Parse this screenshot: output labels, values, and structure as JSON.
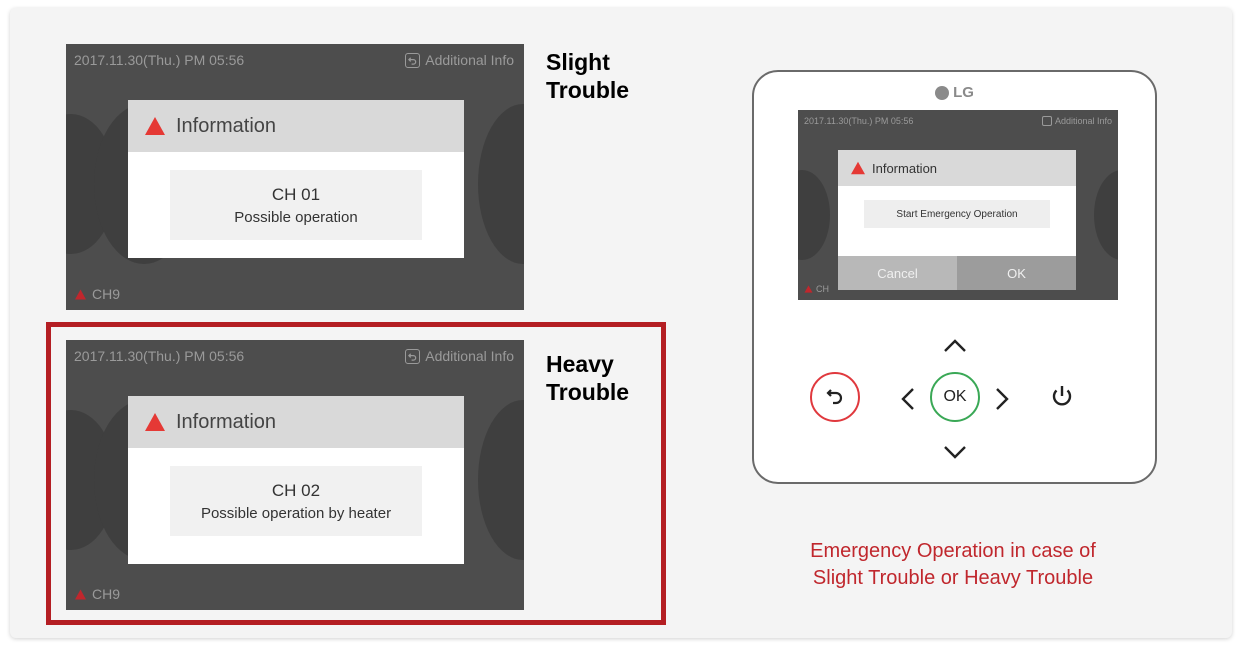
{
  "panel_top": {
    "timestamp": "2017.11.30(Thu.) PM 05:56",
    "additional_info": "Additional Info",
    "dialog_title": "Information",
    "channel": "CH 01",
    "message": "Possible operation",
    "corner_code": "CH9",
    "label_line1": "Slight",
    "label_line2": "Trouble"
  },
  "panel_bottom": {
    "timestamp": "2017.11.30(Thu.) PM 05:56",
    "additional_info": "Additional Info",
    "dialog_title": "Information",
    "channel": "CH 02",
    "message": "Possible operation by heater",
    "corner_code": "CH9",
    "label_line1": "Heavy",
    "label_line2": "Trouble"
  },
  "remote": {
    "brand": "LG",
    "timestamp": "2017.11.30(Thu.) PM 05:56",
    "additional_info": "Additional Info",
    "dialog_title": "Information",
    "message": "Start Emergency Operation",
    "cancel_label": "Cancel",
    "ok_label": "OK",
    "corner_code": "CH",
    "ok_button_label": "OK"
  },
  "caption": {
    "line1": "Emergency Operation in case of",
    "line2": "Slight Trouble or Heavy Trouble"
  },
  "colors": {
    "frame_red": "#b41e23",
    "caption_red": "#c0272d",
    "back_button_red": "#e0393e",
    "ok_button_green": "#3aa856",
    "warning_red": "#e53935"
  }
}
